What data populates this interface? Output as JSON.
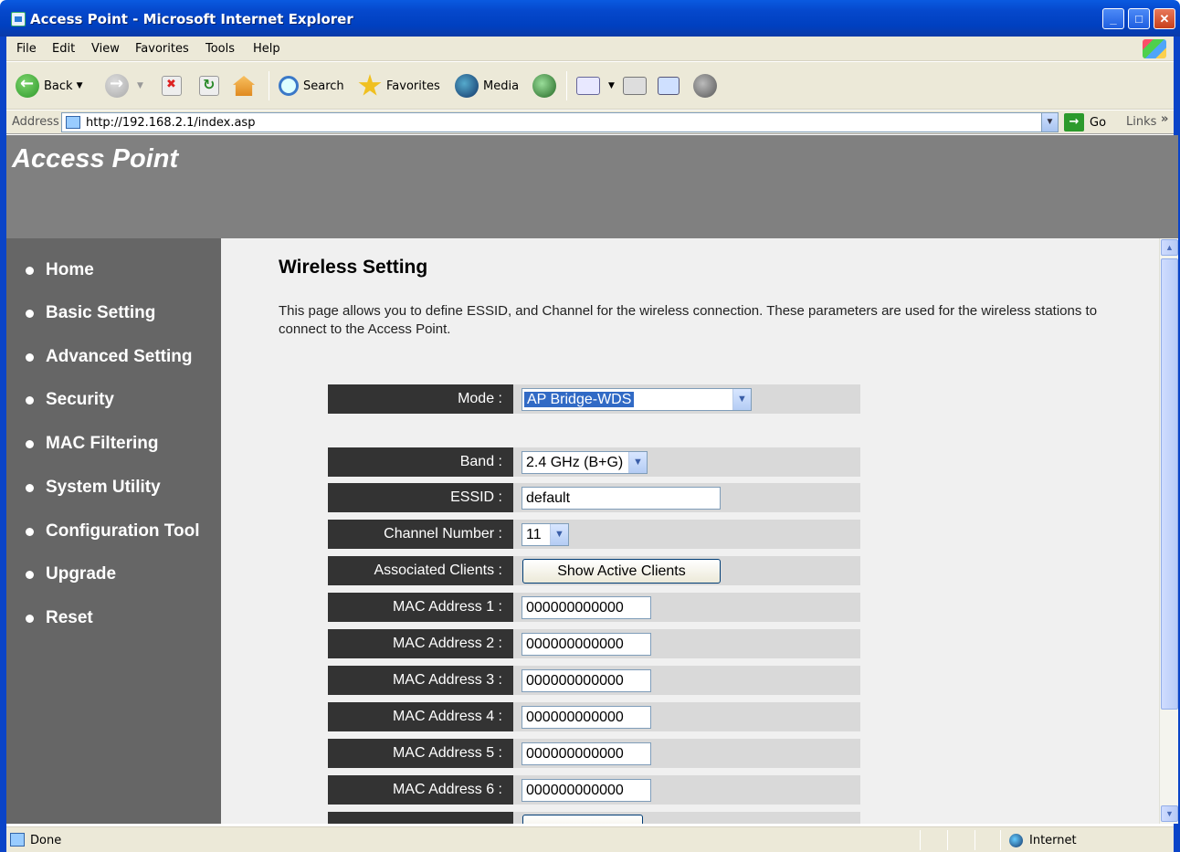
{
  "window": {
    "title": "Access Point - Microsoft Internet Explorer",
    "buttons": {
      "minimize": "_",
      "maximize": "□",
      "close": "✕"
    }
  },
  "menu": [
    "File",
    "Edit",
    "View",
    "Favorites",
    "Tools",
    "Help"
  ],
  "toolbar": {
    "back": "Back",
    "search": "Search",
    "favorites": "Favorites",
    "media": "Media"
  },
  "address": {
    "label": "Address",
    "url": "http://192.168.2.1/index.asp",
    "go": "Go",
    "links": "Links"
  },
  "page": {
    "header_title": "Access Point",
    "sidebar": [
      {
        "label": "Home"
      },
      {
        "label": "Basic Setting"
      },
      {
        "label": "Advanced Setting"
      },
      {
        "label": "Security"
      },
      {
        "label": "MAC Filtering"
      },
      {
        "label": "System Utility"
      },
      {
        "label": "Configuration Tool"
      },
      {
        "label": "Upgrade"
      },
      {
        "label": "Reset"
      }
    ],
    "heading": "Wireless Setting",
    "description": "This page allows you to define ESSID, and Channel for the wireless connection. These parameters are used for the wireless stations to connect to the Access Point.",
    "form": {
      "mode_label": "Mode :",
      "mode_value": "AP Bridge-WDS",
      "band_label": "Band :",
      "band_value": "2.4 GHz (B+G)",
      "essid_label": "ESSID :",
      "essid_value": "default",
      "channel_label": "Channel Number :",
      "channel_value": "11",
      "clients_label": "Associated Clients :",
      "clients_button": "Show Active Clients",
      "mac_rows": [
        {
          "label": "MAC Address 1 :",
          "value": "000000000000"
        },
        {
          "label": "MAC Address 2 :",
          "value": "000000000000"
        },
        {
          "label": "MAC Address 3 :",
          "value": "000000000000"
        },
        {
          "label": "MAC Address 4 :",
          "value": "000000000000"
        },
        {
          "label": "MAC Address 5 :",
          "value": "000000000000"
        },
        {
          "label": "MAC Address 6 :",
          "value": "000000000000"
        }
      ]
    }
  },
  "status": {
    "text": "Done",
    "zone": "Internet"
  }
}
